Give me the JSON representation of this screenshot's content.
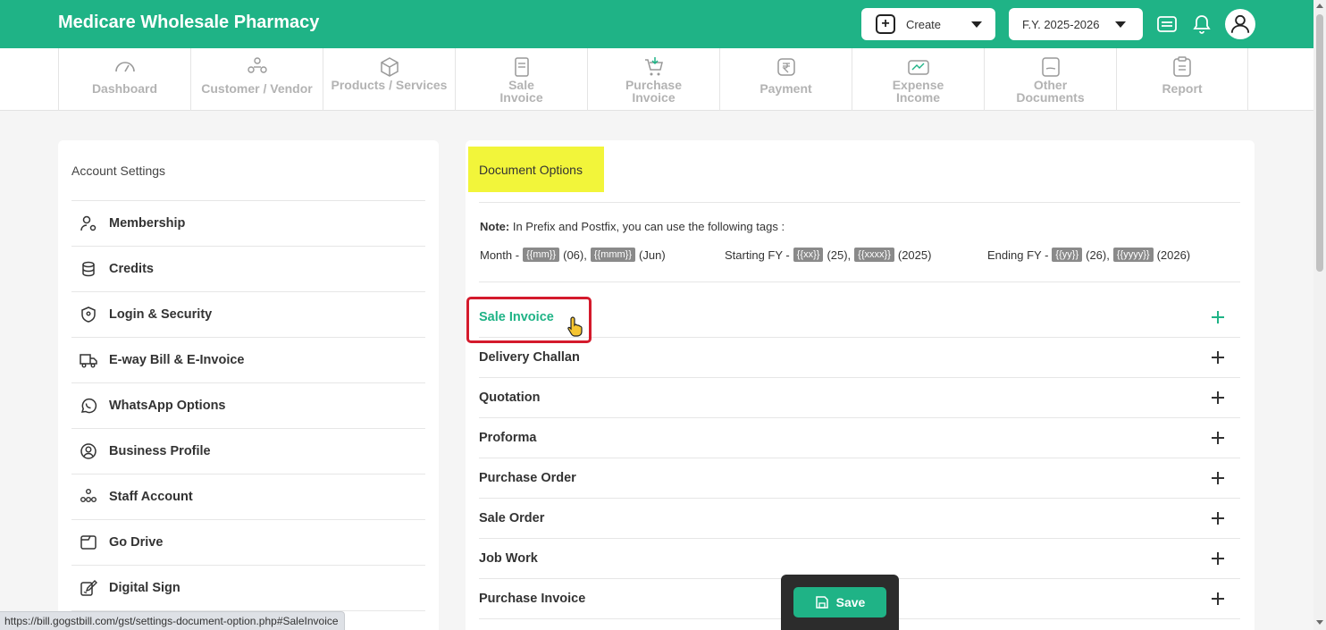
{
  "header": {
    "brand": "Medicare Wholesale Pharmacy",
    "create_label": "Create",
    "fy_label": "F.Y. 2025-2026",
    "accent_color": "#1fb386"
  },
  "nav": {
    "items": [
      {
        "label": "Dashboard",
        "icon": "gauge-icon"
      },
      {
        "label": "Customer / Vendor",
        "icon": "users-icon"
      },
      {
        "label": "Products / Services",
        "icon": "box-icon"
      },
      {
        "label": "Sale\nInvoice",
        "icon": "invoice-icon"
      },
      {
        "label": "Purchase\nInvoice",
        "icon": "cart-icon"
      },
      {
        "label": "Payment",
        "icon": "rupee-icon"
      },
      {
        "label": "Expense\nIncome",
        "icon": "wallet-icon"
      },
      {
        "label": "Other\nDocuments",
        "icon": "document-icon"
      },
      {
        "label": "Report",
        "icon": "clipboard-icon"
      }
    ]
  },
  "account_settings": {
    "title": "Account Settings",
    "items": [
      {
        "label": "Membership",
        "icon": "user-gear-icon"
      },
      {
        "label": "Credits",
        "icon": "coins-icon"
      },
      {
        "label": "Login & Security",
        "icon": "shield-icon"
      },
      {
        "label": "E-way Bill & E-Invoice",
        "icon": "truck-icon"
      },
      {
        "label": "WhatsApp Options",
        "icon": "whatsapp-icon"
      },
      {
        "label": "Business Profile",
        "icon": "user-circle-icon"
      },
      {
        "label": "Staff Account",
        "icon": "team-icon"
      },
      {
        "label": "Go Drive",
        "icon": "folder-icon"
      },
      {
        "label": "Digital Sign",
        "icon": "sign-icon"
      }
    ]
  },
  "document_options": {
    "title": "Document Options",
    "note_bold": "Note:",
    "note_text": " In Prefix and Postfix, you can use the following tags :",
    "month_label": "Month -",
    "month_tag1": "{{mm}}",
    "month_val1": "(06),",
    "month_tag2": "{{mmm}}",
    "month_val2": "(Jun)",
    "start_label": "Starting FY -",
    "start_tag1": "{{xx}}",
    "start_val1": "(25),",
    "start_tag2": "{{xxxx}}",
    "start_val2": "(2025)",
    "end_label": "Ending FY -",
    "end_tag1": "{{yy}}",
    "end_val1": "(26),",
    "end_tag2": "{{yyyy}}",
    "end_val2": "(2026)",
    "rows": [
      {
        "label": "Sale Invoice",
        "active": true
      },
      {
        "label": "Delivery Challan",
        "active": false
      },
      {
        "label": "Quotation",
        "active": false
      },
      {
        "label": "Proforma",
        "active": false
      },
      {
        "label": "Purchase Order",
        "active": false
      },
      {
        "label": "Sale Order",
        "active": false
      },
      {
        "label": "Job Work",
        "active": false
      },
      {
        "label": "Purchase Invoice",
        "active": false
      }
    ]
  },
  "save_label": "Save",
  "status_url": "https://bill.gogstbill.com/gst/settings-document-option.php#SaleInvoice"
}
